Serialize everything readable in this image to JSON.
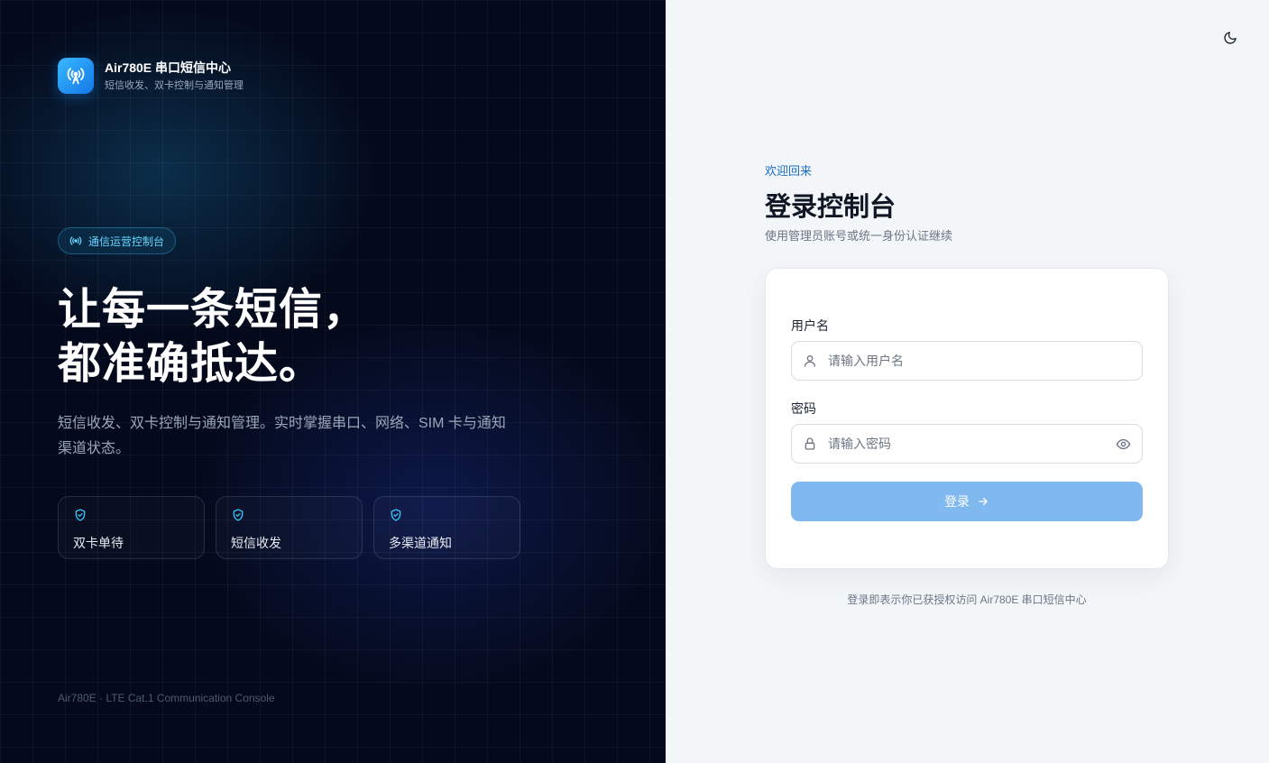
{
  "brand": {
    "title": "Air780E 串口短信中心",
    "subtitle": "短信收发、双卡控制与通知管理",
    "logo_icon": "signal-tower-icon"
  },
  "hero": {
    "badge": "通信运营控制台",
    "headline_line1": "让每一条短信，",
    "headline_line2": "都准确抵达。",
    "description": "短信收发、双卡控制与通知管理。实时掌握串口、网络、SIM 卡与通知渠道状态。",
    "features": [
      {
        "label": "双卡单待",
        "icon": "shield-check-icon"
      },
      {
        "label": "短信收发",
        "icon": "shield-check-icon"
      },
      {
        "label": "多渠道通知",
        "icon": "shield-check-icon"
      }
    ],
    "footer": "Air780E · LTE Cat.1 Communication Console"
  },
  "login": {
    "welcome": "欢迎回来",
    "title": "登录控制台",
    "subtitle": "使用管理员账号或统一身份认证继续",
    "username_label": "用户名",
    "username_placeholder": "请输入用户名",
    "password_label": "密码",
    "password_placeholder": "请输入密码",
    "submit_label": "登录",
    "terms": "登录即表示你已获授权访问 Air780E 串口短信中心"
  },
  "colors": {
    "accent": "#1a6fc4",
    "button": "#80b8f0",
    "badge_text": "#67d5ff",
    "left_bg": "#040a1c"
  }
}
